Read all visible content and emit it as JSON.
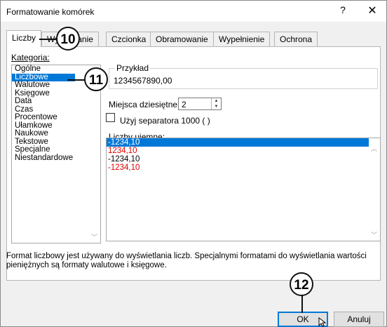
{
  "window": {
    "title": "Formatowanie komórek",
    "help": "?",
    "close": "✕"
  },
  "tabs": [
    {
      "label": "Liczby"
    },
    {
      "label": "Wyrównanie"
    },
    {
      "label": "Czcionka"
    },
    {
      "label": "Obramowanie"
    },
    {
      "label": "Wypełnienie"
    },
    {
      "label": "Ochrona"
    }
  ],
  "category": {
    "label": "Kategoria:",
    "items": [
      "Ogólne",
      "Liczbowe",
      "Walutowe",
      "Księgowe",
      "Data",
      "Czas",
      "Procentowe",
      "Ułamkowe",
      "Naukowe",
      "Tekstowe",
      "Specjalne",
      "Niestandardowe"
    ],
    "selected": "Liczbowe"
  },
  "sample": {
    "label": "Przykład",
    "value": "1234567890,00"
  },
  "decimals": {
    "label": "Miejsca dziesiętne:",
    "value": "2"
  },
  "separator": {
    "label": "Użyj separatora 1000 ( )",
    "checked": false
  },
  "negative": {
    "label": "Liczby ujemne:",
    "items": [
      {
        "text": "-1234,10",
        "color": "#000000"
      },
      {
        "text": "1234,10",
        "color": "#e00000"
      },
      {
        "text": "-1234,10",
        "color": "#000000"
      },
      {
        "text": "-1234,10",
        "color": "#e00000"
      }
    ],
    "selected_index": 0
  },
  "description": "Format liczbowy jest używany do wyświetlania liczb. Specjalnymi formatami do wyświetlania wartości pieniężnych są formaty walutowe i księgowe.",
  "buttons": {
    "ok": "OK",
    "cancel": "Anuluj"
  },
  "annotations": [
    "10",
    "11",
    "12"
  ],
  "colors": {
    "accent": "#0078d7",
    "negative_red": "#e00000"
  }
}
